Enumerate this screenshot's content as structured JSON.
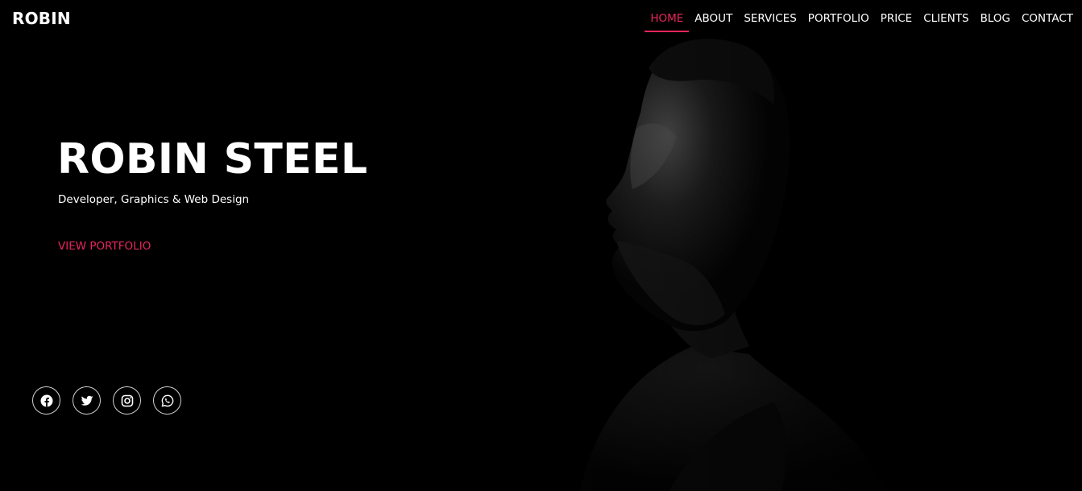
{
  "header": {
    "brand": "ROBIN",
    "nav": [
      {
        "label": "HOME",
        "active": true
      },
      {
        "label": "ABOUT"
      },
      {
        "label": "SERVICES"
      },
      {
        "label": "PORTFOLIO"
      },
      {
        "label": "PRICE"
      },
      {
        "label": "CLIENTS"
      },
      {
        "label": "BLOG"
      },
      {
        "label": "CONTACT"
      }
    ]
  },
  "hero": {
    "title": "ROBIN STEEL",
    "subtitle": "Developer, Graphics & Web Design",
    "cta_label": "VIEW PORTFOLIO",
    "background_image": "portrait of bearded man in profile, dark low-key lighting"
  },
  "socials": [
    {
      "icon": "facebook-icon"
    },
    {
      "icon": "twitter-icon"
    },
    {
      "icon": "instagram-icon"
    },
    {
      "icon": "whatsapp-icon"
    }
  ],
  "colors": {
    "background": "#000000",
    "accent": "#e8265a",
    "text": "#ffffff"
  }
}
